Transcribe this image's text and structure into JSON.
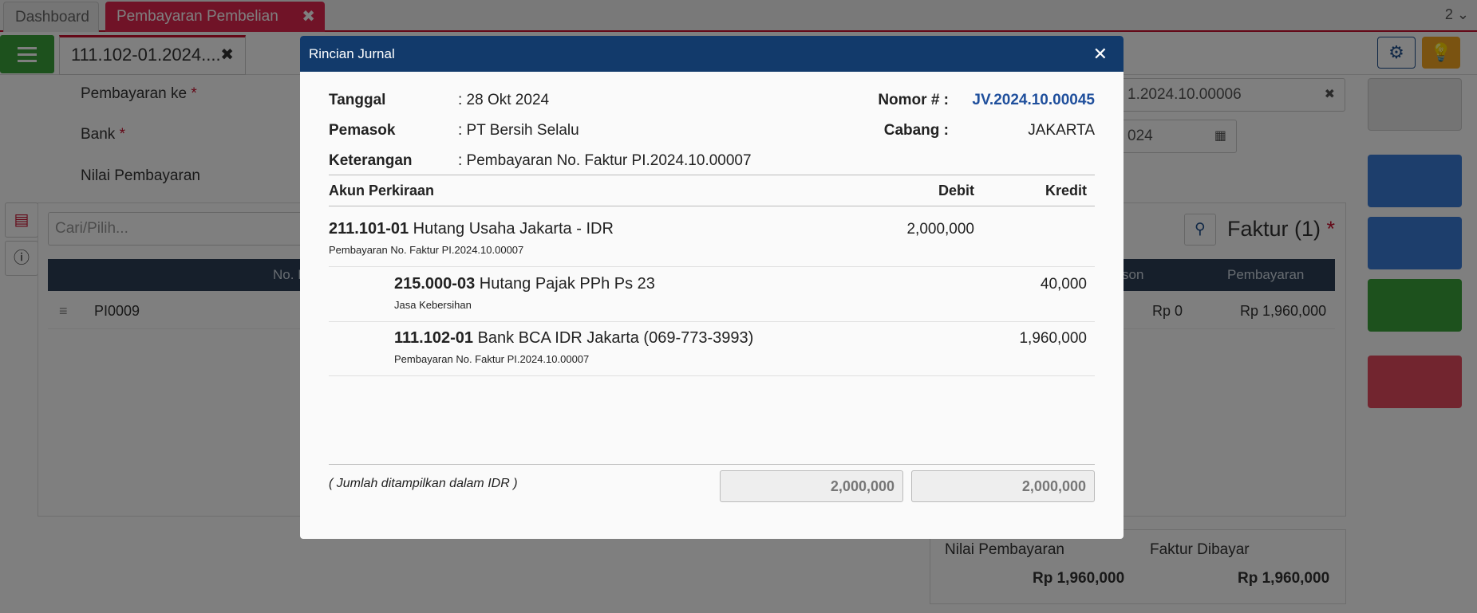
{
  "tabs": {
    "dashboard": "Dashboard",
    "active": "Pembayaran Pembelian",
    "close_glyph": "✖",
    "count": "2 ⌄"
  },
  "doc_tab": {
    "label": "111.102-01.2024....",
    "close_glyph": "✖"
  },
  "form": {
    "payment_to_label": "Pembayaran ke",
    "bank_label": "Bank",
    "amount_label": "Nilai Pembayaran",
    "required_mark": "*",
    "number_value_partial": "1.2024.10.00006",
    "date_value_partial": "024",
    "search_placeholder": "Cari/Pilih...",
    "invoice_header": "Faktur (1)"
  },
  "grid": {
    "col_no": "No. I",
    "col_discount": "son",
    "col_payment": "Pembayaran",
    "row": {
      "invoice": "PI0009",
      "discount": "Rp 0",
      "payment": "Rp 1,960,000"
    }
  },
  "summary": {
    "amount_label": "Nilai Pembayaran",
    "paid_label": "Faktur Dibayar",
    "amount_value": "Rp 1,960,000",
    "paid_value": "Rp 1,960,000"
  },
  "modal": {
    "title": "Rincian Jurnal",
    "close_glyph": "✕",
    "date_label": "Tanggal",
    "date_value": ": 28 Okt 2024",
    "supplier_label": "Pemasok",
    "supplier_value": ": PT Bersih Selalu",
    "note_label": "Keterangan",
    "note_value": ": Pembayaran No. Faktur PI.2024.10.00007",
    "number_label": "Nomor # :",
    "number_value": "JV.2024.10.00045",
    "branch_label": "Cabang :",
    "branch_value": "JAKARTA",
    "col_account": "Akun Perkiraan",
    "col_debit": "Debit",
    "col_credit": "Kredit",
    "lines": [
      {
        "code": "211.101-01",
        "name": "Hutang Usaha Jakarta - IDR",
        "desc": "Pembayaran No. Faktur PI.2024.10.00007",
        "debit": "2,000,000",
        "credit": ""
      },
      {
        "code": "215.000-03",
        "name": "Hutang Pajak PPh Ps 23",
        "desc": "Jasa Kebersihan",
        "debit": "",
        "credit": "40,000"
      },
      {
        "code": "111.102-01",
        "name": "Bank BCA IDR Jakarta (069-773-3993)",
        "desc": "Pembayaran No. Faktur PI.2024.10.00007",
        "debit": "",
        "credit": "1,960,000"
      }
    ],
    "footer_note": "( Jumlah ditampilkan dalam IDR )",
    "total_debit": "2,000,000",
    "total_credit": "2,000,000"
  },
  "colors": {
    "modal_header": "#123a6b",
    "link": "#1f4f9c",
    "tab_active": "#e0264f"
  }
}
